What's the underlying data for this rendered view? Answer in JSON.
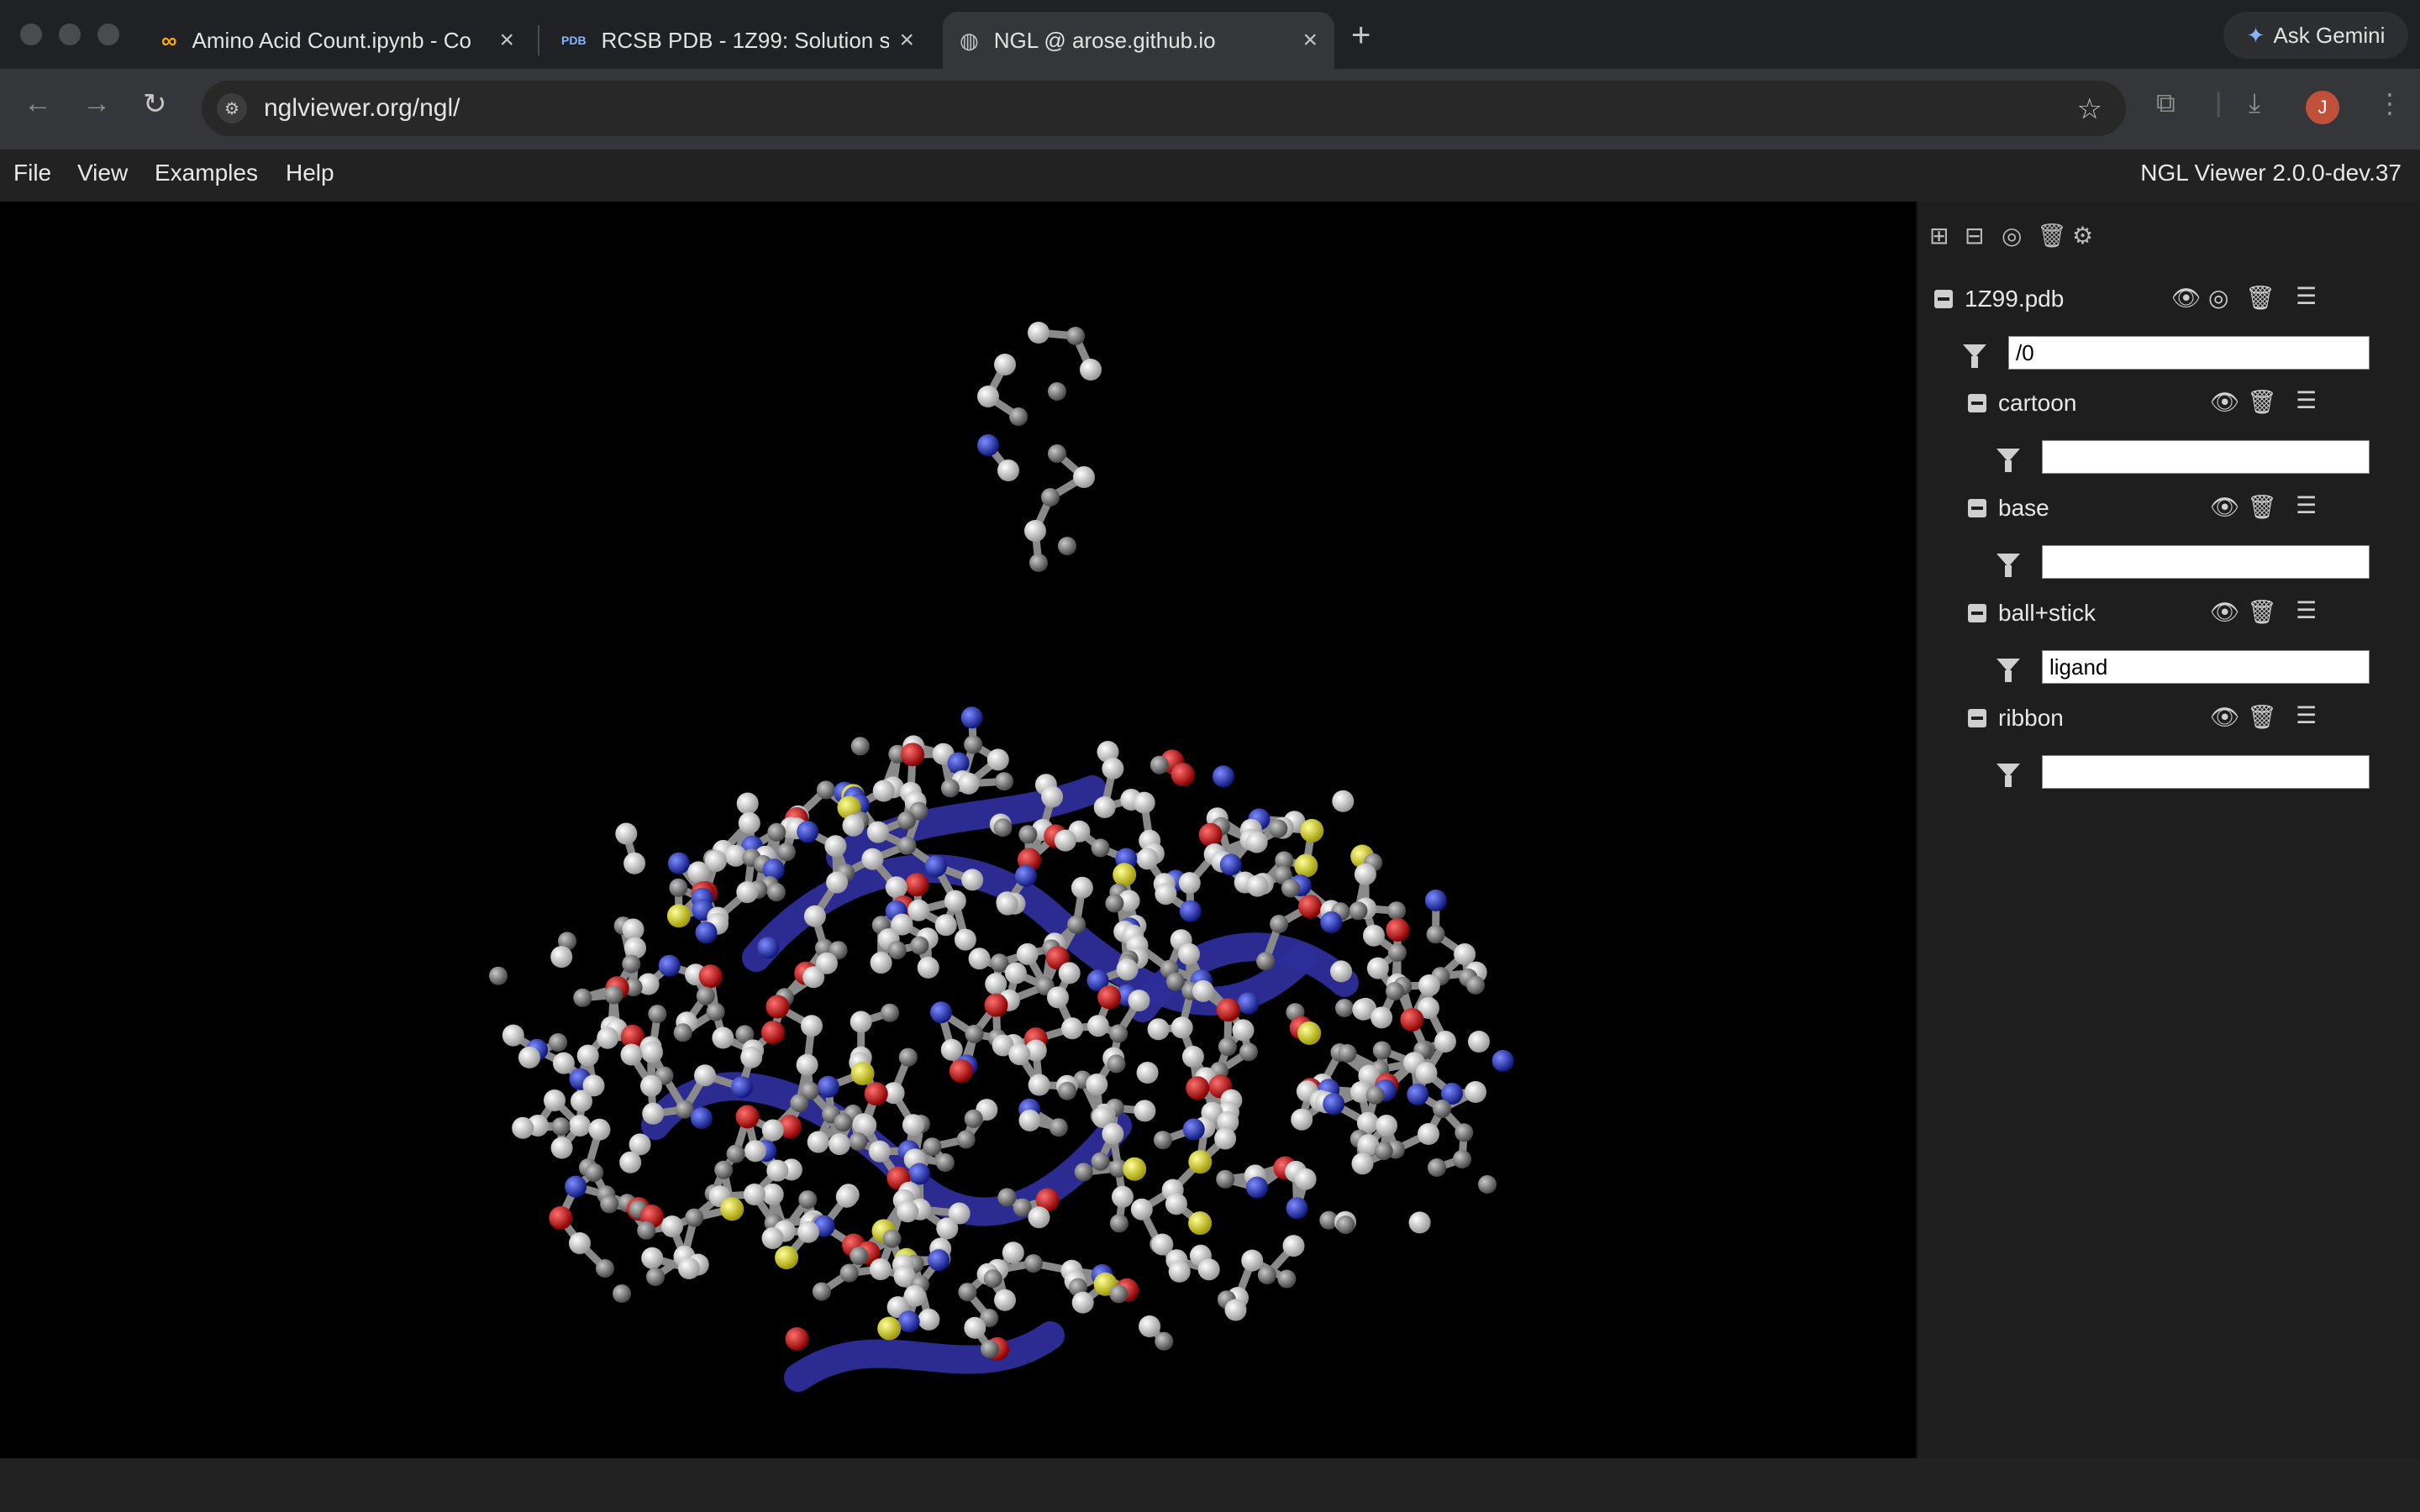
{
  "browser": {
    "tabs": [
      {
        "title": "Amino Acid Count.ipynb - Co",
        "icon": "colab-icon"
      },
      {
        "title": "RCSB PDB - 1Z99: Solution st",
        "icon": "pdb-icon"
      },
      {
        "title": "NGL @ arose.github.io",
        "icon": "globe-icon"
      }
    ],
    "ask_gemini": "Ask Gemini",
    "url": "nglviewer.org/ngl/",
    "avatar_initial": "J"
  },
  "menu": {
    "items": [
      "File",
      "View",
      "Examples",
      "Help"
    ],
    "version": "NGL Viewer 2.0.0-dev.37"
  },
  "sidebar": {
    "component": {
      "name": "1Z99.pdb",
      "filter": "/0"
    },
    "representations": [
      {
        "name": "cartoon",
        "filter": ""
      },
      {
        "name": "base",
        "filter": ""
      },
      {
        "name": "ball+stick",
        "filter": "ligand"
      },
      {
        "name": "ribbon",
        "filter": ""
      }
    ]
  },
  "colors": {
    "carbon": "#8c8c8c",
    "hydrogen": "#eeeeee",
    "oxygen": "#e01010",
    "nitrogen": "#2a3fe0",
    "sulfur": "#e8e030",
    "cartoon": "#2d2d9a"
  }
}
